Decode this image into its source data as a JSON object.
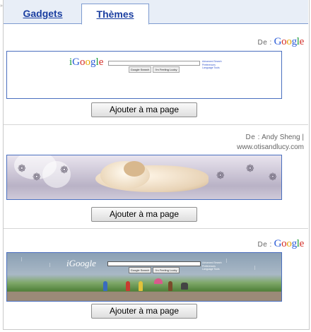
{
  "tabs": [
    {
      "label": "Gadgets",
      "active": false
    },
    {
      "label": "Thèmes",
      "active": true
    }
  ],
  "themes": [
    {
      "author_prefix": "De :",
      "author": "Google",
      "preview": {
        "logo": "iGoogle",
        "search_button": "Google Search",
        "lucky_button": "I'm Feeling Lucky",
        "links": [
          "Advanced Search",
          "Preferences",
          "Language Tools"
        ]
      },
      "button": "Ajouter à ma page"
    },
    {
      "author_prefix": "De :",
      "author": "Andy Sheng |",
      "author_url": "www.otisandlucy.com",
      "preview": {},
      "button": "Ajouter à ma page"
    },
    {
      "author_prefix": "De :",
      "author": "Google",
      "preview": {
        "logo": "iGoogle",
        "search_button": "Google Search",
        "lucky_button": "I'm Feeling Lucky",
        "links": [
          "Advanced Search",
          "Preferences",
          "Language Tools"
        ]
      },
      "button": "Ajouter à ma page"
    }
  ],
  "colors": {
    "tab_link": "#1a3ea0",
    "tab_bar": "#e8eef7",
    "preview_border": "#4a6fbf"
  },
  "icons": [
    "paw-print-icon",
    "google-logo"
  ]
}
